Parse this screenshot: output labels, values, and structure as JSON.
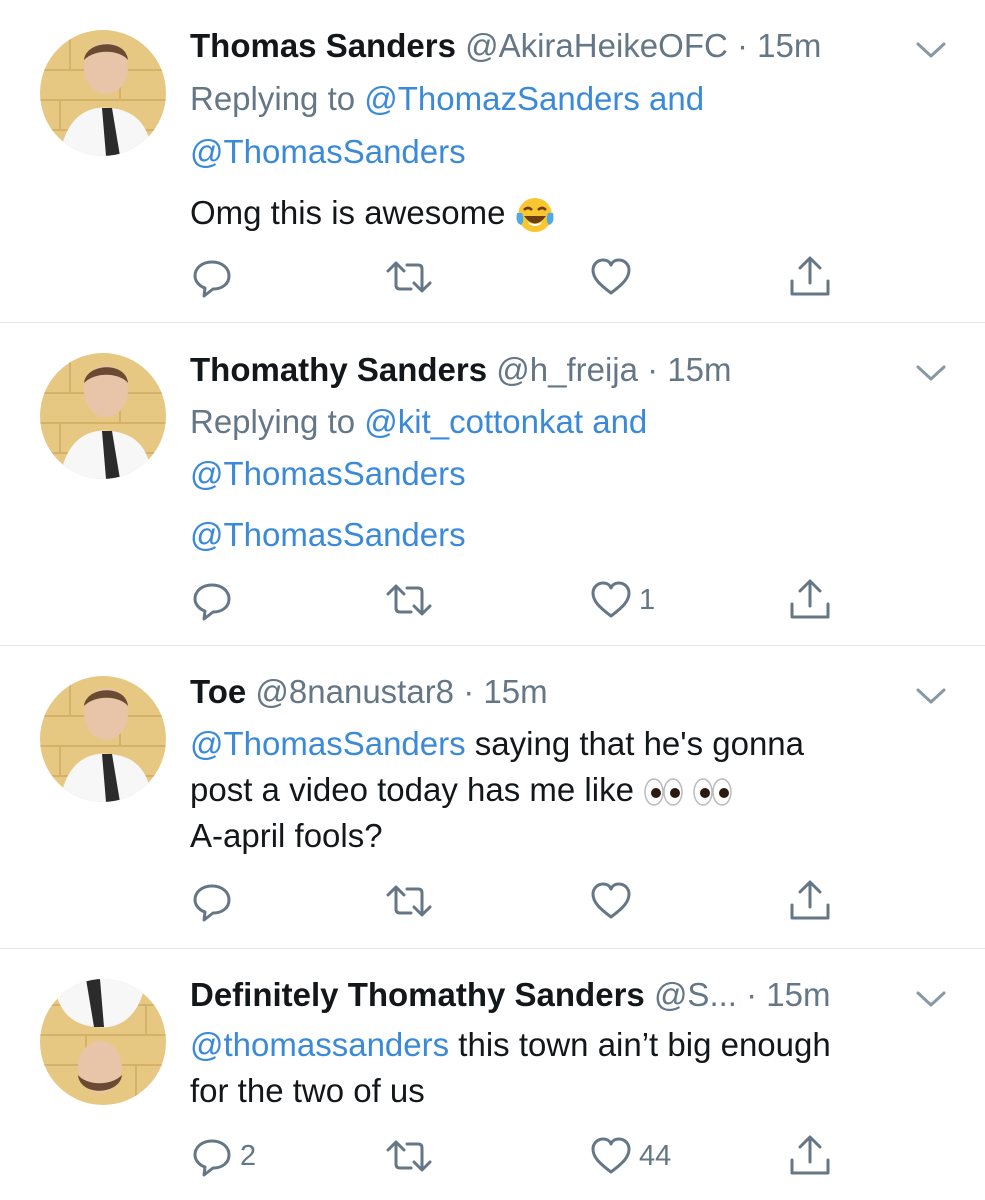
{
  "tweets": [
    {
      "name": "Thomas Sanders",
      "handle": "@AkiraHeikeOFC",
      "time": "15m",
      "reply_prefix": "Replying to ",
      "reply_to_1": "@ThomazSanders",
      "reply_joiner": " and",
      "reply_to_2": "@ThomasSanders",
      "text": "Omg this is awesome",
      "emoji": "face-with-tears-of-joy",
      "replies": "",
      "retweets": "",
      "likes": ""
    },
    {
      "name": "Thomathy Sanders",
      "handle": "@h_freija",
      "time": "15m",
      "reply_prefix": "Replying to ",
      "reply_to_1": "@kit_cottonkat",
      "reply_joiner": " and",
      "reply_to_2": "@ThomasSanders",
      "text": "@ThomasSanders",
      "replies": "",
      "retweets": "",
      "likes": "1"
    },
    {
      "name": "Toe",
      "handle": "@8nanustar8",
      "time": "15m",
      "mention": "@ThomasSanders",
      "text_line1": " saying that he's gonna",
      "text_line2": "post a video today has me like",
      "emoji": "eyes",
      "text_line3": "A-april fools?",
      "replies": "",
      "retweets": "",
      "likes": ""
    },
    {
      "name": "Definitely Thomathy Sanders",
      "handle": "@S...",
      "time": "15m",
      "mention": "@thomassanders",
      "text_line1": " this town ain’t big enough",
      "text_line2": "for the two of us",
      "replies": "2",
      "retweets": "",
      "likes": "44"
    }
  ],
  "separator": " · ",
  "colors": {
    "link": "#3b8ad9",
    "secondary": "#657786",
    "divider": "#e1e8ed",
    "text": "#14171a"
  },
  "icons": [
    "reply-icon",
    "retweet-icon",
    "like-icon",
    "share-icon",
    "chevron-down-icon"
  ]
}
